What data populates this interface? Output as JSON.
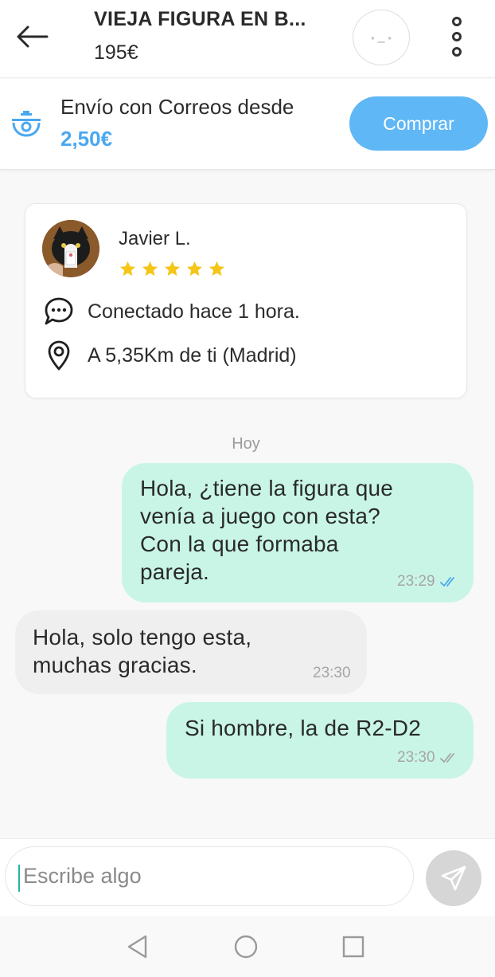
{
  "header": {
    "item_title": "VIEJA FIGURA EN B...",
    "item_price": "195€"
  },
  "shipping": {
    "text": "Envío con Correos desde",
    "price": "2,50€",
    "buy_label": "Comprar"
  },
  "seller": {
    "name": "Javier L.",
    "rating": 5,
    "status": "Conectado hace 1 hora.",
    "location": "A 5,35Km de ti (Madrid)"
  },
  "chat": {
    "date_label": "Hoy",
    "messages": [
      {
        "direction": "sent",
        "text": "Hola, ¿tiene la figura que\nvenía a juego con esta?\nCon la que formaba\npareja.",
        "time": "23:29",
        "read": true
      },
      {
        "direction": "received",
        "text": "Hola, solo tengo esta,\nmuchas gracias.",
        "time": "23:30"
      },
      {
        "direction": "sent",
        "text": "Si hombre, la de R2-D2",
        "time": "23:30",
        "read": false
      }
    ]
  },
  "composer": {
    "placeholder": "Escribe algo"
  },
  "colors": {
    "accent": "#5fb7f5",
    "sent_bubble": "#c9f5e6",
    "received_bubble": "#efefef",
    "star": "#f5c518",
    "read_check": "#4aa8f0",
    "unread_check": "#a6a6a6"
  },
  "icons": {
    "back": "arrow-left-icon",
    "menu": "more-vertical-icon",
    "shipping": "correos-horn-icon",
    "status": "chat-bubble-icon",
    "location": "location-pin-icon",
    "send": "paper-plane-icon"
  }
}
